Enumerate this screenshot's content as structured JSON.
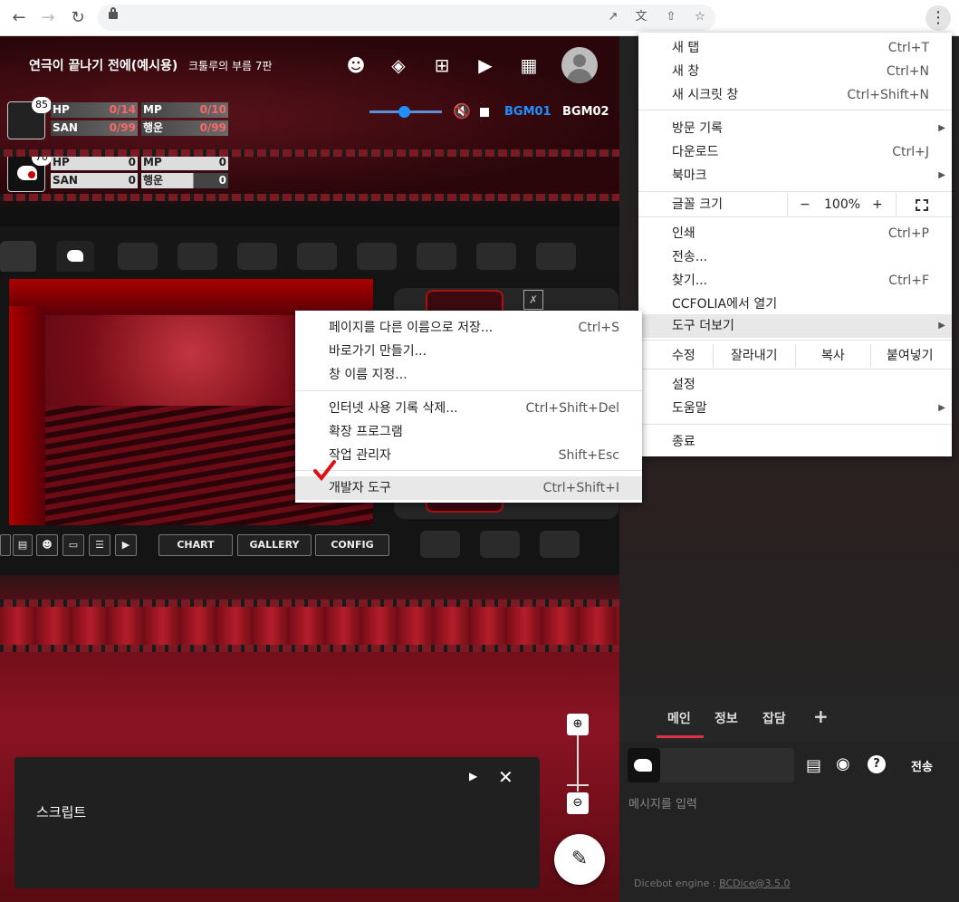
{
  "browser": {
    "icons": [
      "back-icon",
      "forward-icon",
      "reload-icon",
      "lock-icon",
      "open-in-new-icon",
      "translate-icon",
      "share-icon",
      "star-icon",
      "more-vert-icon"
    ],
    "back": "←",
    "forward": "→",
    "reload": "↻",
    "more": "⋮"
  },
  "room": {
    "title": "연극이 끝나기 전에(예시용)",
    "subtitle": "크툴루의 부름 7판",
    "bgm1": "BGM01",
    "bgm2": "BGM02"
  },
  "characters": [
    {
      "badge": "85",
      "hp_label": "HP",
      "hp": "0/14",
      "mp_label": "MP",
      "mp": "0/10",
      "san_label": "SAN",
      "san": "0/99",
      "luck_label": "행운",
      "luck": "0/99"
    },
    {
      "badge": "70",
      "hp_label": "HP",
      "hp": "0",
      "mp_label": "MP",
      "mp": "0",
      "san_label": "SAN",
      "san": "0",
      "luck_label": "행운",
      "luck": "0"
    }
  ],
  "toolbar": {
    "chart": "CHART",
    "gallery": "GALLERY",
    "config": "CONFIG"
  },
  "chrome_menu": {
    "new_tab": "새 탭",
    "new_tab_key": "Ctrl+T",
    "new_window": "새 창",
    "new_window_key": "Ctrl+N",
    "incognito": "새 시크릿 창",
    "incognito_key": "Ctrl+Shift+N",
    "history": "방문 기록",
    "downloads": "다운로드",
    "downloads_key": "Ctrl+J",
    "bookmarks": "북마크",
    "zoom_label": "글꼴 크기",
    "zoom_minus": "−",
    "zoom_value": "100%",
    "zoom_plus": "+",
    "print": "인쇄",
    "print_key": "Ctrl+P",
    "cast": "전송...",
    "find": "찾기...",
    "find_key": "Ctrl+F",
    "open_in": "CCFOLIA에서 열기",
    "more_tools": "도구 더보기",
    "edit": "수정",
    "cut": "잘라내기",
    "copy": "복사",
    "paste": "붙여넣기",
    "settings": "설정",
    "help": "도움말",
    "exit": "종료"
  },
  "more_tools_menu": {
    "save_as": "페이지를 다른 이름으로 저장...",
    "save_as_key": "Ctrl+S",
    "shortcut": "바로가기 만들기...",
    "name_window": "창 이름 지정...",
    "clear_data": "인터넷 사용 기록 삭제...",
    "clear_data_key": "Ctrl+Shift+Del",
    "extensions": "확장 프로그램",
    "task_manager": "작업 관리자",
    "task_manager_key": "Shift+Esc",
    "devtools": "개발자 도구",
    "devtools_key": "Ctrl+Shift+I"
  },
  "script_panel": {
    "label": "스크립트"
  },
  "chat": {
    "tab_main": "메인",
    "tab_info": "정보",
    "tab_chat": "잡담",
    "add": "+",
    "send": "전송",
    "placeholder": "메시지를 입력",
    "footer": "Dicebot engine : ",
    "footer_link": "BCDice@3.5.0"
  },
  "colors": {
    "accent_blue": "#1e90ff",
    "menu_highlight": "#e8e8e8",
    "check_red": "#e01010",
    "stage_red": "#8a1322"
  }
}
